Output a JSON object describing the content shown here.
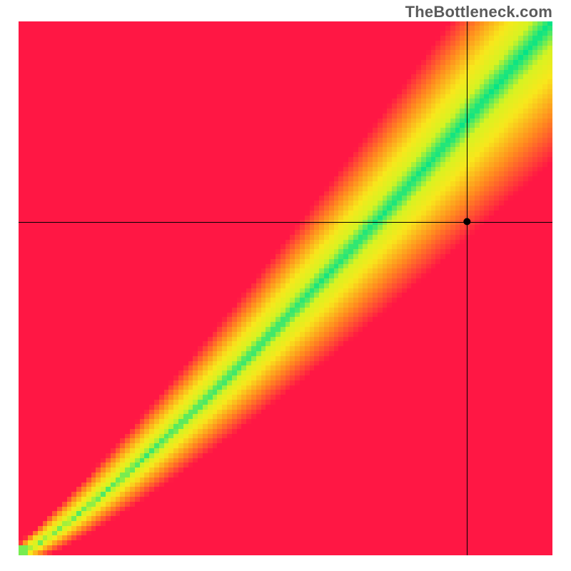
{
  "watermark": "TheBottleneck.com",
  "chart_data": {
    "type": "heatmap",
    "title": "",
    "xlabel": "",
    "ylabel": "",
    "xlim": [
      0,
      1
    ],
    "ylim": [
      0,
      1
    ],
    "grid_size": 110,
    "crosshair": {
      "x": 0.84,
      "y": 0.625
    },
    "marker": {
      "x": 0.84,
      "y": 0.625,
      "radius": 5
    },
    "color_stops": [
      {
        "t": 0.0,
        "color": "#ff1744"
      },
      {
        "t": 0.33,
        "color": "#ff8a1f"
      },
      {
        "t": 0.62,
        "color": "#f8e71c"
      },
      {
        "t": 0.82,
        "color": "#d6f322"
      },
      {
        "t": 1.0,
        "color": "#00e38a"
      }
    ],
    "ideal_curve": {
      "description": "Green ridge where CPU and GPU are balanced; widens toward top-right",
      "type": "power_curve",
      "comment": "approx y ~ x^1.18, width grows linearly with x"
    },
    "legend": []
  }
}
